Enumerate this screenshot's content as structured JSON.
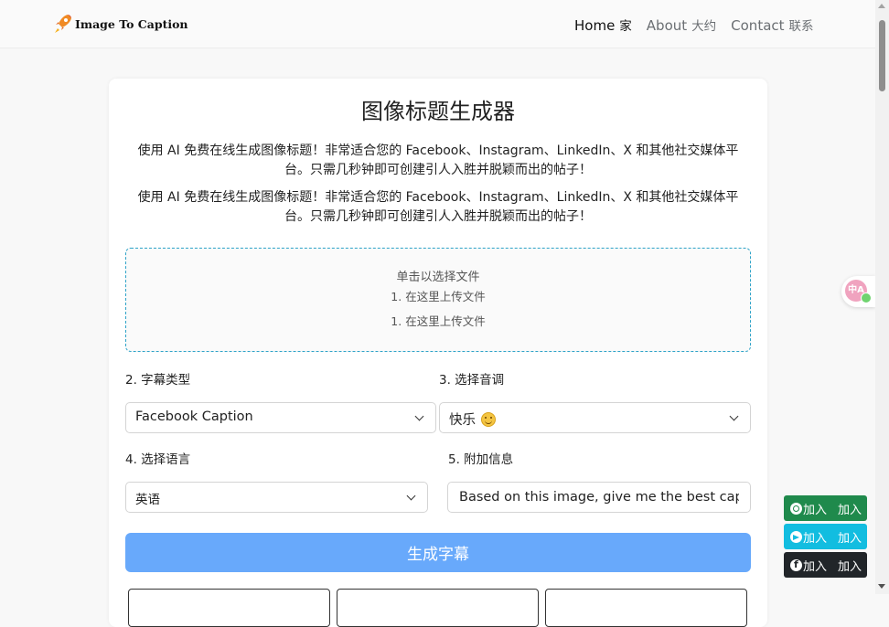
{
  "header": {
    "brand": "Image To Caption",
    "nav": [
      {
        "label": "Home",
        "cn": "家"
      },
      {
        "label": "About",
        "cn": "大约"
      },
      {
        "label": "Contact",
        "cn": "联系"
      }
    ]
  },
  "main": {
    "title": "图像标题生成器",
    "description_1": "使用 AI 免费在线生成图像标题！非常适合您的 Facebook、Instagram、LinkedIn、X 和其他社交媒体平台。只需几秒钟即可创建引人入胜并脱颖而出的帖子！",
    "description_2": "使用 AI 免费在线生成图像标题！非常适合您的 Facebook、Instagram、LinkedIn、X 和其他社交媒体平台。只需几秒钟即可创建引人入胜并脱颖而出的帖子！",
    "upload": {
      "main": "单击以选择文件",
      "line1": "1. 在这里上传文件",
      "line2": "1. 在这里上传文件"
    },
    "caption_type": {
      "label": "2. 字幕类型",
      "value": "Facebook Caption"
    },
    "tone": {
      "label": "3. 选择音调",
      "value": "快乐",
      "emoji": "smiling-face-icon"
    },
    "language": {
      "label": "4. 选择语言",
      "value": "英语"
    },
    "extra_info": {
      "label": "5. 附加信息",
      "value": "Based on this image, give me the best caption"
    },
    "generate_label": "生成字幕"
  },
  "floating": {
    "translate_icon": "translate-icon",
    "join_whatsapp": {
      "a": "加入",
      "b": "加入",
      "icon": "whatsapp-icon"
    },
    "join_telegram": {
      "a": "加入",
      "b": "加入",
      "icon": "telegram-icon"
    },
    "join_facebook": {
      "a": "加入",
      "b": "加入",
      "icon": "facebook-icon"
    }
  },
  "colors": {
    "primary_button": "#68a9fb",
    "dropzone_border": "#2ea3c8",
    "whatsapp": "#1f8a4c",
    "telegram": "#12bde0",
    "facebook": "#212529"
  }
}
